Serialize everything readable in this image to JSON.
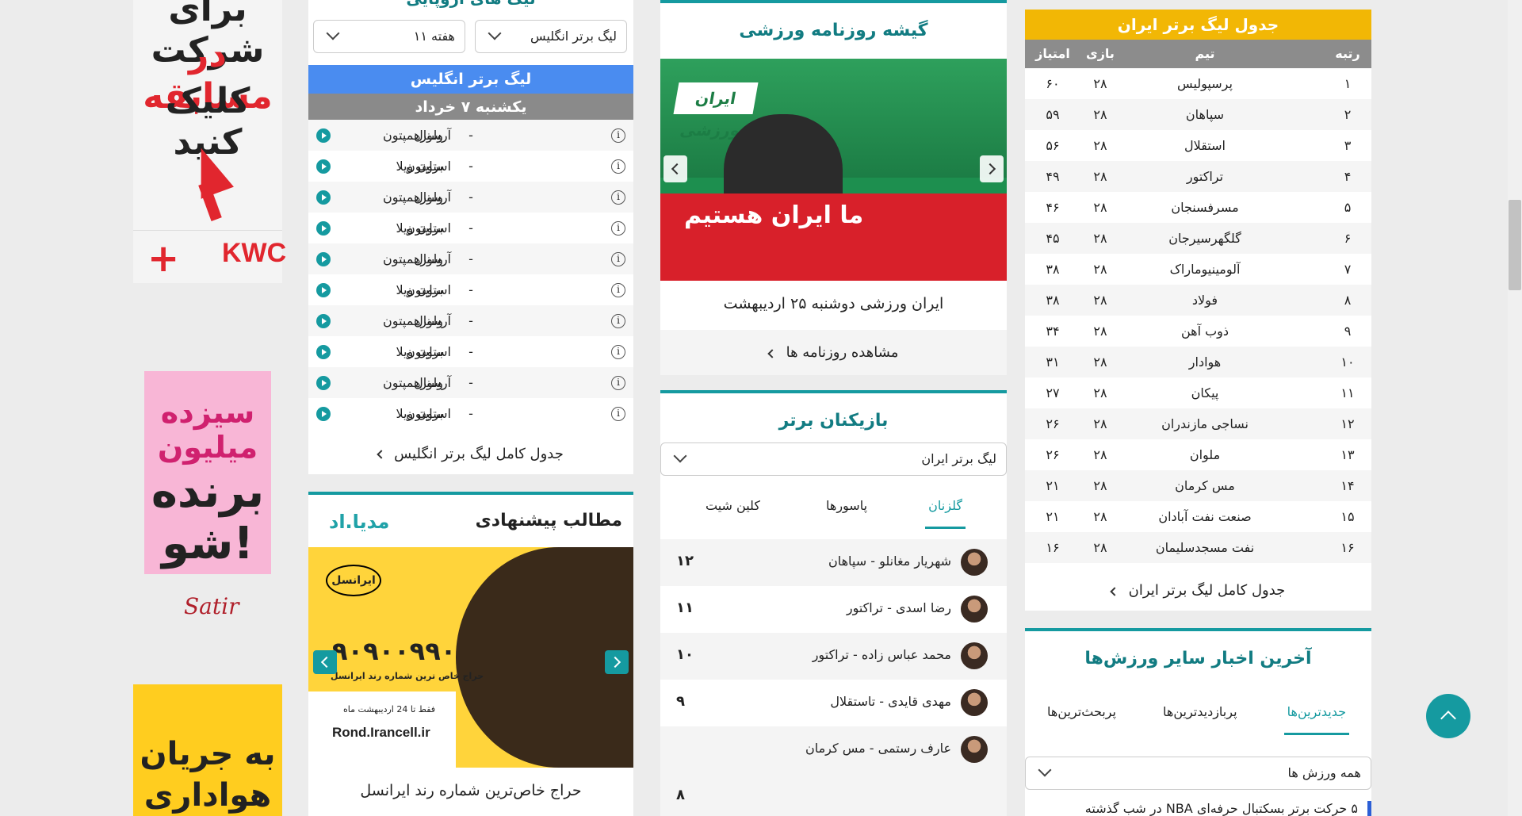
{
  "ads": {
    "ad1_lines": [
      "برای شرکت",
      "در مسابقه",
      "کلیک کنید"
    ],
    "ad1_brand": "KWC",
    "ad2_line1": "سیزده میلیون",
    "ad2_line2": "برنده شو!",
    "ad3_brand": "Satir",
    "ad3_lines": [
      "به جریان",
      "هواداری"
    ]
  },
  "fixtures": {
    "title": "لیگ های اروپایی",
    "league_select": "لیگ برتر انگلیس",
    "week_select": "هفته ۱۱",
    "league_bar": "لیگ برتر انگلیس",
    "date_bar": "یکشنبه ۷ خرداد",
    "matches": [
      {
        "home": "آرسنال",
        "away": "ولورهمپتون"
      },
      {
        "home": "استون ویلا",
        "away": "برایتون"
      },
      {
        "home": "آرسنال",
        "away": "ولورهمپتون"
      },
      {
        "home": "استون ویلا",
        "away": "برایتون"
      },
      {
        "home": "آرسنال",
        "away": "ولورهمپتون"
      },
      {
        "home": "استون ویلا",
        "away": "برایتون"
      },
      {
        "home": "آرسنال",
        "away": "ولورهمپتون"
      },
      {
        "home": "استون ویلا",
        "away": "برایتون"
      },
      {
        "home": "آرسنال",
        "away": "ولورهمپتون"
      },
      {
        "home": "استون ویلا",
        "away": "برایتون"
      }
    ],
    "dash": "-",
    "info_glyph": "i",
    "more_link": "جدول کامل لیگ برتر انگلیس"
  },
  "suggested": {
    "title": "مطالب پیشنهادی",
    "brand": "مدیا.اد",
    "img_operator": "ایرانسل",
    "img_number": "۹۰۹۰۰۹۹۰",
    "img_sub": "حراج خاص ترین شماره رند ایرانسل",
    "img_deadline": "فقط تا 24 اردیبهشت ماه",
    "img_url": "Rond.Irancell.ir",
    "caption": "حراج خاص‌ترین شماره رند ایرانسل"
  },
  "newspaper": {
    "title": "گیشه روزنامه ورزشی",
    "img_logo": "ایران ورزشی",
    "img_headline": "ما ایران هستیم",
    "caption": "ایران ورزشی دوشنبه ۲۵ اردیبهشت",
    "more_link": "مشاهده روزنامه ها"
  },
  "players": {
    "title": "بازیکنان برتر",
    "league_select": "لیگ برتر ایران",
    "tabs": [
      "گلزنان",
      "پاسورها",
      "کلین شیت"
    ],
    "list": [
      {
        "name": "شهریار مغانلو - سپاهان",
        "goals": "۱۲"
      },
      {
        "name": "رضا اسدی - تراکتور",
        "goals": "۱۱"
      },
      {
        "name": "محمد عباس زاده - تراکتور",
        "goals": "۱۰"
      },
      {
        "name": "مهدی قایدی - تاستقلال",
        "goals": "۹"
      },
      {
        "name": "عارف رستمی - مس کرمان",
        "goals": "۸"
      }
    ]
  },
  "league": {
    "title": "جدول لیگ برتر ایران",
    "columns": {
      "rank": "رتبه",
      "team": "تیم",
      "played": "بازی",
      "points": "امتیاز"
    },
    "rows": [
      {
        "rank": "۱",
        "team": "پرسپولیس",
        "played": "۲۸",
        "points": "۶۰"
      },
      {
        "rank": "۲",
        "team": "سپاهان",
        "played": "۲۸",
        "points": "۵۹"
      },
      {
        "rank": "۳",
        "team": "استقلال",
        "played": "۲۸",
        "points": "۵۶"
      },
      {
        "rank": "۴",
        "team": "تراکتور",
        "played": "۲۸",
        "points": "۴۹"
      },
      {
        "rank": "۵",
        "team": "مسرفسنجان",
        "played": "۲۸",
        "points": "۴۶"
      },
      {
        "rank": "۶",
        "team": "گلگهرسیرجان",
        "played": "۲۸",
        "points": "۴۵"
      },
      {
        "rank": "۷",
        "team": "آلومینیوماراک",
        "played": "۲۸",
        "points": "۳۸"
      },
      {
        "rank": "۸",
        "team": "فولاد",
        "played": "۲۸",
        "points": "۳۸"
      },
      {
        "rank": "۹",
        "team": "ذوب آهن",
        "played": "۲۸",
        "points": "۳۴"
      },
      {
        "rank": "۱۰",
        "team": "هوادار",
        "played": "۲۸",
        "points": "۳۱"
      },
      {
        "rank": "۱۱",
        "team": "پیکان",
        "played": "۲۸",
        "points": "۲۷"
      },
      {
        "rank": "۱۲",
        "team": "نساجی مازندران",
        "played": "۲۸",
        "points": "۲۶"
      },
      {
        "rank": "۱۳",
        "team": "ملوان",
        "played": "۲۸",
        "points": "۲۶"
      },
      {
        "rank": "۱۴",
        "team": "مس کرمان",
        "played": "۲۸",
        "points": "۲۱"
      },
      {
        "rank": "۱۵",
        "team": "صنعت نفت آبادان",
        "played": "۲۸",
        "points": "۲۱"
      },
      {
        "rank": "۱۶",
        "team": "نفت مسجدسلیمان",
        "played": "۲۸",
        "points": "۱۶"
      }
    ],
    "more_link": "جدول کامل لیگ برتر ایران"
  },
  "sports": {
    "title": "آخرین اخبار سایر ورزش‌ها",
    "tabs": [
      "جدیدترین‌ها",
      "پربازدیدترین‌ها",
      "پربحث‌ترین‌ها"
    ],
    "filter_select": "همه ورزش ها",
    "first_news": "۵ حرکت برتر بسکتبال حرفه‌ای NBA در شب گذشته"
  }
}
